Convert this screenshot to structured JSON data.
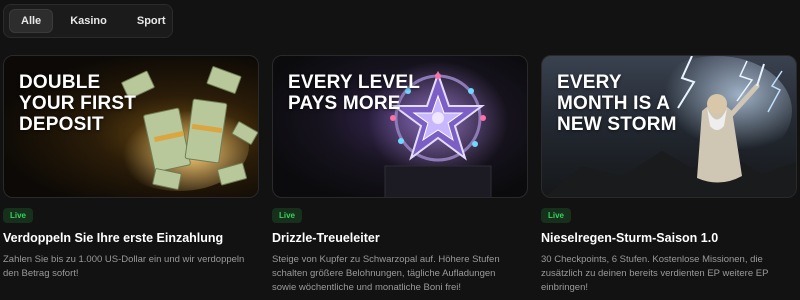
{
  "tabs": [
    {
      "label": "Alle",
      "active": true
    },
    {
      "label": "Kasino",
      "active": false
    },
    {
      "label": "Sport",
      "active": false
    }
  ],
  "cards": [
    {
      "headline": "DOUBLE YOUR FIRST DEPOSIT",
      "badge": "Live",
      "title": "Verdoppeln Sie Ihre erste Einzahlung",
      "description": "Zahlen Sie bis zu 1.000 US-Dollar ein und wir verdoppeln den Betrag sofort!",
      "image": "money-stacks-image"
    },
    {
      "headline": "EVERY LEVEL PAYS MORE",
      "badge": "Live",
      "title": "Drizzle-Treueleiter",
      "description": "Steige von Kupfer zu Schwarzopal auf. Höhere Stufen schalten größere Belohnungen, tägliche Aufladungen sowie wöchentliche und monatliche Boni frei!",
      "image": "star-gem-trophy-image"
    },
    {
      "headline": "EVERY MONTH IS A NEW STORM",
      "badge": "Live",
      "title": "Nieselregen-Sturm-Saison 1.0",
      "description": "30 Checkpoints, 6 Stufen. Kostenlose Missionen, die zusätzlich zu deinen bereits verdienten EP weitere EP einbringen!",
      "image": "storm-god-lightning-image"
    }
  ],
  "colors": {
    "background": "#121212",
    "badge_text": "#34d35d",
    "badge_bg": "#16301c",
    "description": "#9a9a9a"
  }
}
